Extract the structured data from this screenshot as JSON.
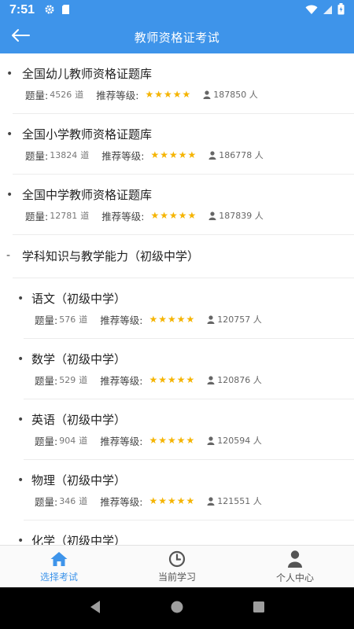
{
  "status_bar": {
    "time": "7:51"
  },
  "header": {
    "title": "教师资格证考试"
  },
  "labels": {
    "count": "题量:",
    "unit": "道",
    "rating": "推荐等级:",
    "people_unit": "人"
  },
  "list": [
    {
      "title": "全国幼儿教师资格证题库",
      "count": "4526",
      "stars": 5,
      "users": "187850"
    },
    {
      "title": "全国小学教师资格证题库",
      "count": "13824",
      "stars": 5,
      "users": "186778"
    },
    {
      "title": "全国中学教师资格证题库",
      "count": "12781",
      "stars": 5,
      "users": "187839"
    }
  ],
  "category": {
    "marker": "-",
    "title": "学科知识与教学能力（初级中学）"
  },
  "subjects": [
    {
      "title": "语文（初级中学）",
      "count": "576",
      "stars": 5,
      "users": "120757"
    },
    {
      "title": "数学（初级中学）",
      "count": "529",
      "stars": 5,
      "users": "120876"
    },
    {
      "title": "英语（初级中学）",
      "count": "904",
      "stars": 5,
      "users": "120594"
    },
    {
      "title": "物理（初级中学）",
      "count": "346",
      "stars": 5,
      "users": "121551"
    },
    {
      "title": "化学（初级中学）"
    }
  ],
  "tabs": [
    {
      "label": "选择考试",
      "icon": "home-icon",
      "active": true
    },
    {
      "label": "当前学习",
      "icon": "clock-icon",
      "active": false
    },
    {
      "label": "个人中心",
      "icon": "person-icon",
      "active": false
    }
  ],
  "colors": {
    "primary": "#3e94ea",
    "star": "#f5b400"
  }
}
